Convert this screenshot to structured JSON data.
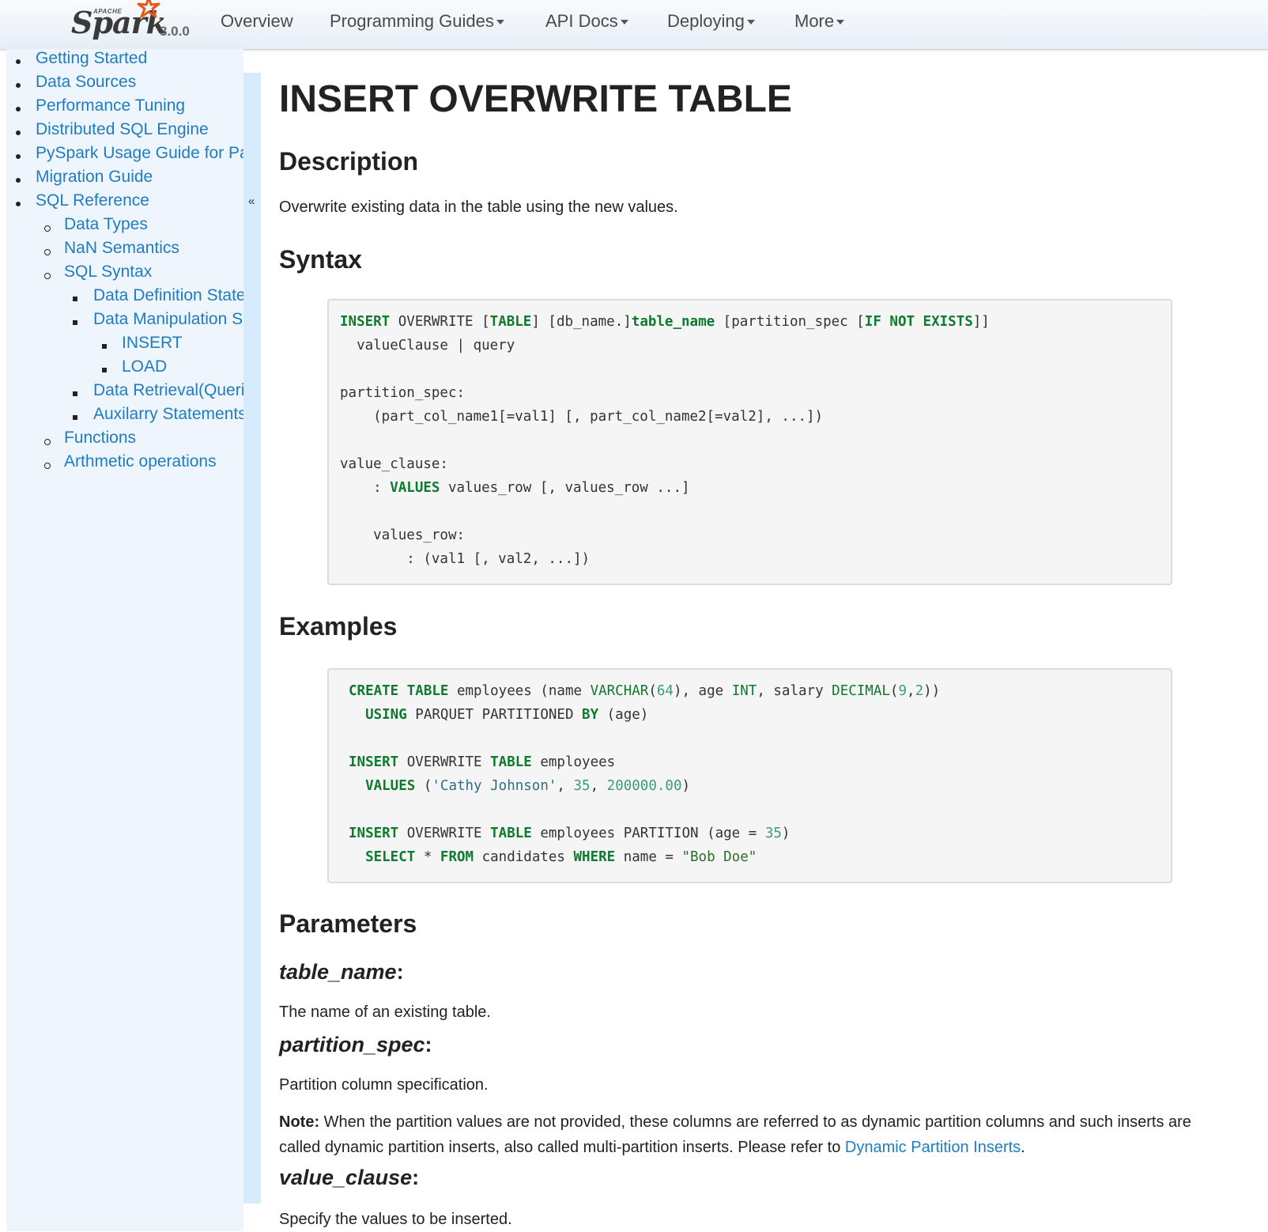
{
  "navbar": {
    "brand_apache": "APACHE",
    "brand_name": "Spark",
    "version": "3.0.0",
    "items": [
      {
        "label": "Overview",
        "dropdown": false
      },
      {
        "label": "Programming Guides",
        "dropdown": true
      },
      {
        "label": "API Docs",
        "dropdown": true
      },
      {
        "label": "Deploying",
        "dropdown": true
      },
      {
        "label": "More",
        "dropdown": true
      }
    ]
  },
  "sidebar": {
    "collapse_glyph": "«",
    "items": [
      {
        "label": "Getting Started",
        "level": 1
      },
      {
        "label": "Data Sources",
        "level": 1
      },
      {
        "label": "Performance Tuning",
        "level": 1
      },
      {
        "label": "Distributed SQL Engine",
        "level": 1
      },
      {
        "label": "PySpark Usage Guide for Pa",
        "level": 1
      },
      {
        "label": "Migration Guide",
        "level": 1
      },
      {
        "label": "SQL Reference",
        "level": 1
      },
      {
        "label": "Data Types",
        "level": 2
      },
      {
        "label": "NaN Semantics",
        "level": 2
      },
      {
        "label": "SQL Syntax",
        "level": 2
      },
      {
        "label": "Data Definition State",
        "level": 3
      },
      {
        "label": "Data Manipulation S",
        "level": 3
      },
      {
        "label": "INSERT",
        "level": 4
      },
      {
        "label": "LOAD",
        "level": 4
      },
      {
        "label": "Data Retrieval(Queri",
        "level": 3
      },
      {
        "label": "Auxilarry Statements",
        "level": 3
      },
      {
        "label": "Functions",
        "level": 2
      },
      {
        "label": "Arthmetic operations",
        "level": 2
      }
    ]
  },
  "main": {
    "title": "INSERT OVERWRITE TABLE",
    "description_heading": "Description",
    "description_text": "Overwrite existing data in the table using the new values.",
    "syntax_heading": "Syntax",
    "examples_heading": "Examples",
    "parameters_heading": "Parameters",
    "params": {
      "table_name": {
        "name": "table_name",
        "colon": ":",
        "desc": "The name of an existing table."
      },
      "partition_spec": {
        "name": "partition_spec",
        "colon": ":",
        "desc": "Partition column specification.",
        "note_label": "Note:",
        "note_text": " When the partition values are not provided, these columns are referred to as dynamic partition columns and such inserts are called dynamic partition inserts, also called multi-partition inserts. Please refer to ",
        "note_link": "Dynamic Partition Inserts",
        "note_end": "."
      },
      "value_clause": {
        "name": "value_clause",
        "colon": ":",
        "desc": "Specify the values to be inserted."
      }
    }
  },
  "code": {
    "syntax": [
      [
        [
          "kw",
          "INSERT"
        ],
        [
          "p",
          " OVERWRITE ["
        ],
        [
          "kw",
          "TABLE"
        ],
        [
          "p",
          "] [db_name.]"
        ],
        [
          "kw",
          "table_name"
        ],
        [
          "p",
          " [partition_spec ["
        ],
        [
          "kw",
          "IF NOT EXISTS"
        ],
        [
          "p",
          "]]"
        ]
      ],
      [
        [
          "p",
          "  valueClause | query"
        ]
      ],
      [],
      [
        [
          "p",
          "partition_spec:"
        ]
      ],
      [
        [
          "p",
          "    (part_col_name1[=val1] [, part_col_name2[=val2], ...])"
        ]
      ],
      [],
      [
        [
          "p",
          "value_clause:"
        ]
      ],
      [
        [
          "p",
          "    : "
        ],
        [
          "kw",
          "VALUES"
        ],
        [
          "p",
          " values_row [, values_row ...]"
        ]
      ],
      [],
      [
        [
          "p",
          "    values_row:"
        ]
      ],
      [
        [
          "p",
          "        : (val1 [, val2, ...])"
        ]
      ]
    ],
    "examples": [
      [
        [
          "kw",
          "CREATE TABLE"
        ],
        [
          "p",
          " employees (name "
        ],
        [
          "ty",
          "VARCHAR"
        ],
        [
          "p",
          "("
        ],
        [
          "num",
          "64"
        ],
        [
          "p",
          "), age "
        ],
        [
          "ty",
          "INT"
        ],
        [
          "p",
          ", salary "
        ],
        [
          "ty",
          "DECIMAL"
        ],
        [
          "p",
          "("
        ],
        [
          "num",
          "9"
        ],
        [
          "p",
          ","
        ],
        [
          "num",
          "2"
        ],
        [
          "p",
          "))"
        ]
      ],
      [
        [
          "p",
          "  "
        ],
        [
          "kw",
          "USING"
        ],
        [
          "p",
          " PARQUET PARTITIONED "
        ],
        [
          "kw",
          "BY"
        ],
        [
          "p",
          " (age)"
        ]
      ],
      [],
      [
        [
          "kw",
          "INSERT"
        ],
        [
          "p",
          " OVERWRITE "
        ],
        [
          "kw",
          "TABLE"
        ],
        [
          "p",
          " employees"
        ]
      ],
      [
        [
          "p",
          "  "
        ],
        [
          "kw",
          "VALUES"
        ],
        [
          "p",
          " ("
        ],
        [
          "str",
          "'Cathy Johnson'"
        ],
        [
          "p",
          ", "
        ],
        [
          "num",
          "35"
        ],
        [
          "p",
          ", "
        ],
        [
          "num",
          "200000.00"
        ],
        [
          "p",
          ")"
        ]
      ],
      [],
      [
        [
          "kw",
          "INSERT"
        ],
        [
          "p",
          " OVERWRITE "
        ],
        [
          "kw",
          "TABLE"
        ],
        [
          "p",
          " employees PARTITION (age = "
        ],
        [
          "num",
          "35"
        ],
        [
          "p",
          ")"
        ]
      ],
      [
        [
          "p",
          "  "
        ],
        [
          "kw",
          "SELECT"
        ],
        [
          "p",
          " * "
        ],
        [
          "kw",
          "FROM"
        ],
        [
          "p",
          " candidates "
        ],
        [
          "kw",
          "WHERE"
        ],
        [
          "p",
          " name = "
        ],
        [
          "str2",
          "\"Bob Doe\""
        ]
      ]
    ]
  },
  "colors": {
    "link": "#1f7cc1",
    "keyword": "#0e7a2e",
    "number": "#3c9a7e",
    "sidebar_bg": "#eef5fc",
    "splitter": "#d6ecfc",
    "code_bg": "#f5f5f5"
  }
}
